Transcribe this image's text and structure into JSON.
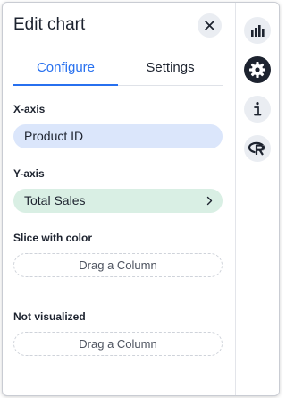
{
  "header": {
    "title": "Edit chart",
    "close_icon": "close-icon"
  },
  "tabs": [
    {
      "label": "Configure",
      "active": true
    },
    {
      "label": "Settings",
      "active": false
    }
  ],
  "x_axis": {
    "label": "X-axis",
    "value": "Product ID"
  },
  "y_axis": {
    "label": "Y-axis",
    "value": "Total Sales"
  },
  "slice_with_color": {
    "label": "Slice with color",
    "placeholder": "Drag a Column"
  },
  "not_visualized": {
    "label": "Not visualized",
    "placeholder": "Drag a Column"
  },
  "rail": {
    "items": [
      {
        "icon": "bar-chart-icon",
        "active": false
      },
      {
        "icon": "gear-icon",
        "active": true
      },
      {
        "icon": "info-icon",
        "active": false
      },
      {
        "icon": "r-script-icon",
        "active": false
      }
    ]
  },
  "colors": {
    "accent": "#2770ef",
    "x_pill": "#dbe6fb",
    "y_pill": "#d9efe4",
    "rail_active": "#1d232f"
  }
}
